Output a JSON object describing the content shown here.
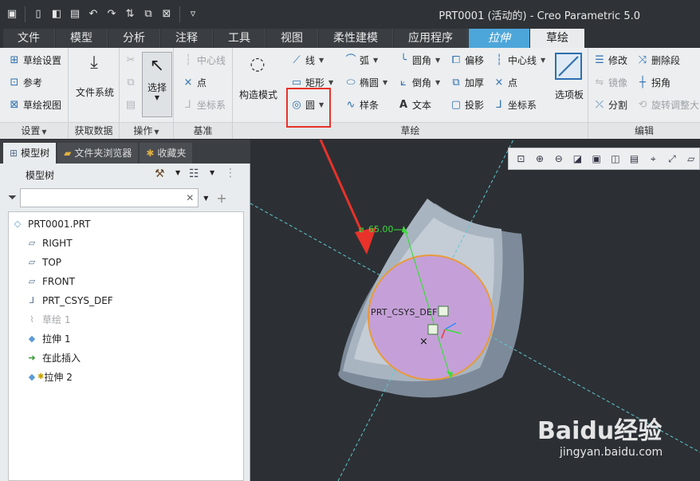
{
  "window": {
    "title": "PRT0001 (活动的) - Creo Parametric 5.0"
  },
  "tabs": [
    {
      "label": "文件"
    },
    {
      "label": "模型"
    },
    {
      "label": "分析"
    },
    {
      "label": "注释"
    },
    {
      "label": "工具"
    },
    {
      "label": "视图"
    },
    {
      "label": "柔性建模"
    },
    {
      "label": "应用程序"
    },
    {
      "label": "拉伸"
    },
    {
      "label": "草绘"
    }
  ],
  "ribbon": {
    "settings": {
      "items": [
        "草绘设置",
        "参考",
        "草绘视图"
      ],
      "group_label": "设置"
    },
    "data": {
      "file_system": "文件系统",
      "group_label": "获取数据"
    },
    "ops": {
      "select": "选择",
      "group_label": "操作"
    },
    "datum": {
      "items": [
        "中心线",
        "点",
        "坐标系"
      ],
      "group_label": "基准"
    },
    "sketch": {
      "construction": "构造模式",
      "col1": [
        "线",
        "矩形",
        "圆"
      ],
      "col2": [
        "弧",
        "椭圆",
        "样条"
      ],
      "col3": [
        "圆角",
        "倒角",
        "文本"
      ],
      "col4": [
        "偏移",
        "加厚",
        "投影"
      ],
      "col5": [
        "中心线",
        "点",
        "坐标系"
      ],
      "palette": "选项板",
      "group_label": "草绘"
    },
    "edit": {
      "col1": [
        "修改",
        "镜像",
        "分割"
      ],
      "col2": [
        "删除段",
        "拐角",
        "旋转调整大"
      ],
      "group_label": "编辑"
    }
  },
  "left_panel": {
    "tabs": [
      "模型树",
      "文件夹浏览器",
      "收藏夹"
    ],
    "header": "模型树",
    "filter_placeholder": "",
    "tree": [
      {
        "label": "PRT0001.PRT",
        "icon": "part-icon"
      },
      {
        "label": "RIGHT",
        "icon": "datum-plane-icon"
      },
      {
        "label": "TOP",
        "icon": "datum-plane-icon"
      },
      {
        "label": "FRONT",
        "icon": "datum-plane-icon"
      },
      {
        "label": "PRT_CSYS_DEF",
        "icon": "csys-icon"
      },
      {
        "label": "草绘 1",
        "icon": "sketch-icon"
      },
      {
        "label": "拉伸 1",
        "icon": "extrude-icon"
      },
      {
        "label": "在此插入",
        "icon": "insert-arrow-icon"
      },
      {
        "label": "拉伸 2",
        "icon": "extrude-icon"
      }
    ]
  },
  "viewport": {
    "dimension": "65.00",
    "csys_label": "PRT_CSYS_DEF",
    "watermark_brand": "Baidu经验",
    "watermark_url": "jingyan.baidu.com",
    "colors": {
      "circle_fill": "#c5a0d8",
      "circle_stroke": "#e89a3a",
      "solid": "#9aa7b6",
      "centerline": "#5ec8d0"
    }
  }
}
